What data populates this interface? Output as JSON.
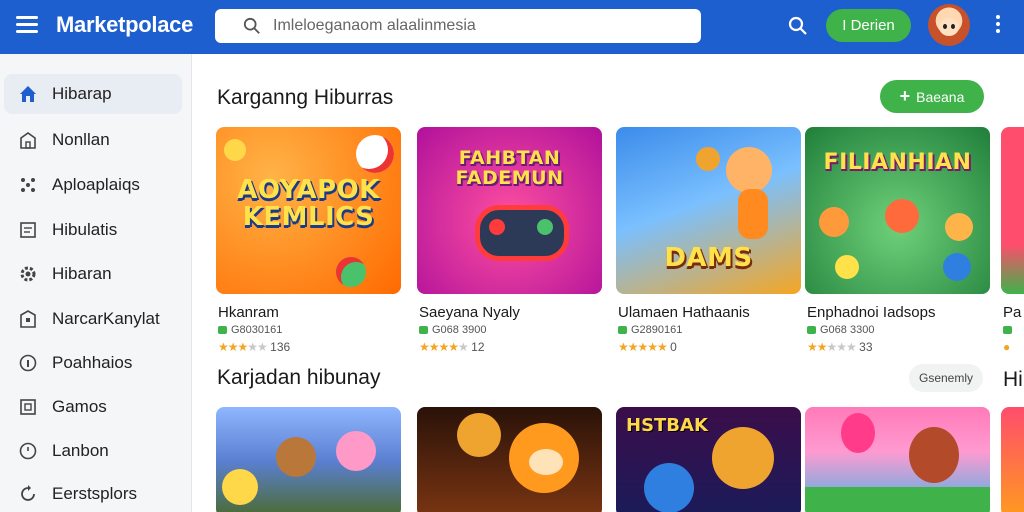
{
  "app": {
    "brand": "Marketpolace"
  },
  "search": {
    "placeholder": "Imleloeganaom alaalinmesia"
  },
  "header": {
    "login_label": "I Derien"
  },
  "sidebar": {
    "items": [
      {
        "label": "Hibarap",
        "icon": "home-icon"
      },
      {
        "label": "Nonllan",
        "icon": "bag-icon"
      },
      {
        "label": "Aploaplaiqs",
        "icon": "apps-icon"
      },
      {
        "label": "Hibulatis",
        "icon": "document-icon"
      },
      {
        "label": "Hibaran",
        "icon": "gear-icon"
      },
      {
        "label": "NarcarKanylat",
        "icon": "store-icon"
      },
      {
        "label": "Poahhaios",
        "icon": "info-icon"
      },
      {
        "label": "Gamos",
        "icon": "image-icon"
      },
      {
        "label": "Lanbon",
        "icon": "clock-icon"
      },
      {
        "label": "Eerstsplors",
        "icon": "refresh-icon"
      }
    ]
  },
  "main": {
    "section1": {
      "title": "Karganng Hiburras",
      "button_label": "Baeana"
    },
    "section2": {
      "title": "Karjadan hibunay",
      "chip_label": "Gsenemly",
      "next_title": "Hi"
    },
    "cards": [
      {
        "title": "Hkanram",
        "art": "AOYAPOK KEMLICS",
        "size": "G8030161",
        "rating": 3,
        "rating_count": "136",
        "colors": [
          "#ff9a1f",
          "#ff6a00"
        ]
      },
      {
        "title": "Saeyana Nyaly",
        "art": "FAHBTAN FADEMUN",
        "size": "G068 3900",
        "rating": 3.5,
        "rating_count": "12",
        "colors": [
          "#ff3d8a",
          "#c11bb0"
        ]
      },
      {
        "title": "Ulamaen Hathaanis",
        "art": "DAMS",
        "size": "G2890161",
        "rating": 5,
        "rating_count": "0",
        "colors": [
          "#2f7fe0",
          "#f0a430"
        ]
      },
      {
        "title": "Enphadnoi Iadsops",
        "art": "FILIANHIAN",
        "size": "G068 3300",
        "rating": 2,
        "rating_count": "33",
        "colors": [
          "#33b34d",
          "#1c7f3a"
        ]
      },
      {
        "title": "Pa",
        "art": "",
        "size": "",
        "rating": 0,
        "rating_count": "",
        "colors": [
          "#ff4d6d",
          "#3fb24a"
        ]
      }
    ],
    "cards_row2": [
      {
        "art": "",
        "colors": [
          "#7aa8ff",
          "#3d6b2f"
        ]
      },
      {
        "art": "",
        "colors": [
          "#3a1a0a",
          "#8a3b12"
        ]
      },
      {
        "art": "HSTBAK",
        "colors": [
          "#3b0e4a",
          "#1b1b5a"
        ]
      },
      {
        "art": "",
        "colors": [
          "#ff6aa8",
          "#3ab5e8"
        ]
      },
      {
        "art": "",
        "colors": [
          "#ff4d6d",
          "#ff9a1f"
        ]
      }
    ]
  }
}
